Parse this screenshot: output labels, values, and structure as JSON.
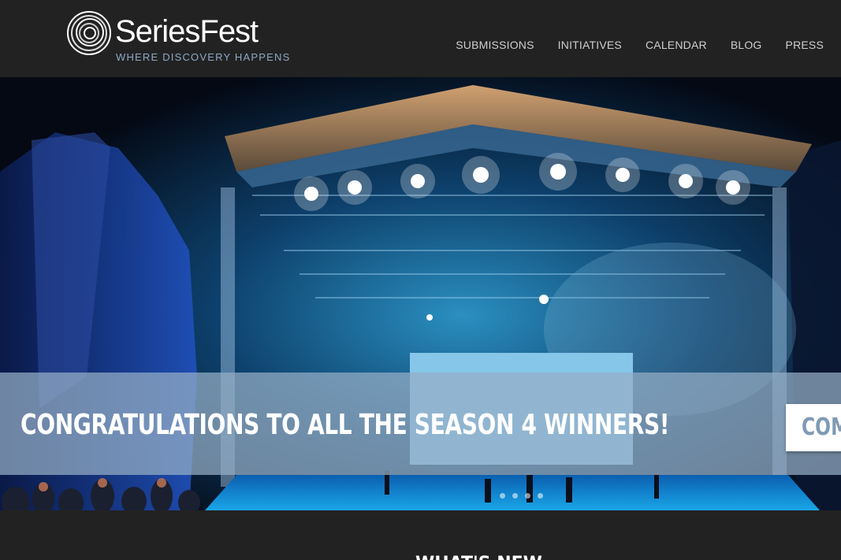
{
  "brand": {
    "name": "SeriesFest",
    "tagline": "WHERE DISCOVERY HAPPENS"
  },
  "nav": {
    "items": [
      {
        "label": "SUBMISSIONS"
      },
      {
        "label": "INITIATIVES"
      },
      {
        "label": "CALENDAR"
      },
      {
        "label": "BLOG"
      },
      {
        "label": "PRESS"
      }
    ]
  },
  "hero": {
    "image": "concert-stage-photo",
    "headline": "CONGRATULATIONS TO ALL THE SEASON 4 WINNERS!",
    "button_label": "COMI",
    "slides_count": 4,
    "active_slide": 1
  },
  "bottom": {
    "heading": "WHAT'S NEW"
  },
  "colors": {
    "header_bg": "#222222",
    "tagline": "#8ea9c4",
    "banner_overlay": "#96afc6",
    "button_text": "#7f9ab4"
  }
}
